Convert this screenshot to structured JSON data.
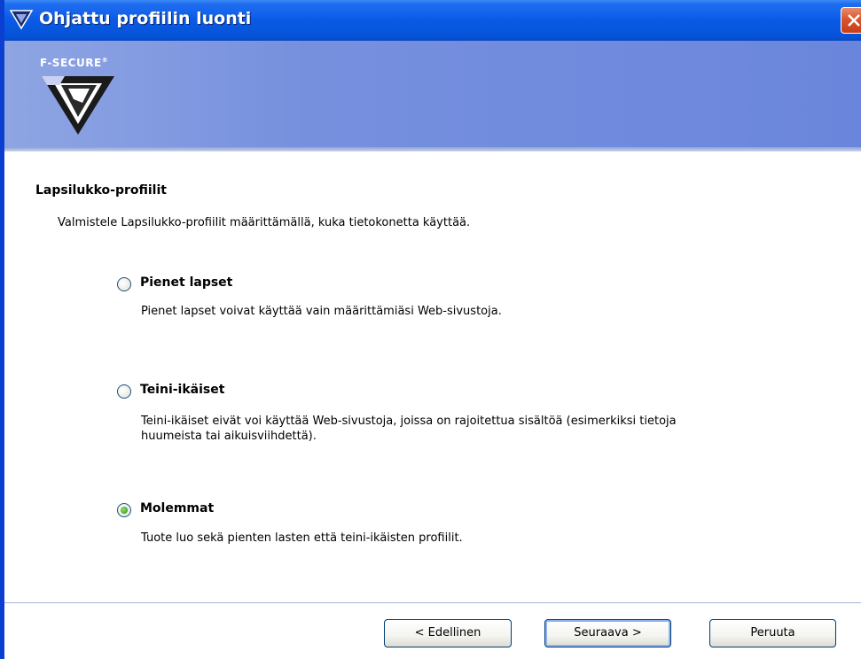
{
  "window": {
    "title": "Ohjattu profiilin luonti"
  },
  "banner": {
    "logo_text": "F-SECURE",
    "logo_mark": "®"
  },
  "content": {
    "section_title": "Lapsilukko-profiilit",
    "section_description": "Valmistele Lapsilukko-profiilit määrittämällä, kuka tietokonetta käyttää.",
    "options": [
      {
        "label": "Pienet lapset",
        "description_lines": [
          "Pienet lapset voivat käyttää vain määrittämiäsi Web-sivustoja."
        ],
        "selected": false
      },
      {
        "label": "Teini-ikäiset",
        "description_lines": [
          "Teini-ikäiset eivät voi käyttää Web-sivustoja, joissa on rajoitettua sisältöä (esimerkiksi tietoja",
          "huumeista tai aikuisviihdettä)."
        ],
        "selected": false
      },
      {
        "label": "Molemmat",
        "description_lines": [
          "Tuote luo sekä pienten lasten että teini-ikäisten profiilit."
        ],
        "selected": true
      }
    ]
  },
  "buttons": {
    "back": "< Edellinen",
    "next": "Seuraava >",
    "cancel": "Peruuta"
  },
  "colors": {
    "titlebar": "#0a5ae6",
    "banner": "#7790de",
    "radio_checked": "#3ea528"
  },
  "icons": {
    "title": "f-secure-logo-icon",
    "close": "close-icon"
  }
}
